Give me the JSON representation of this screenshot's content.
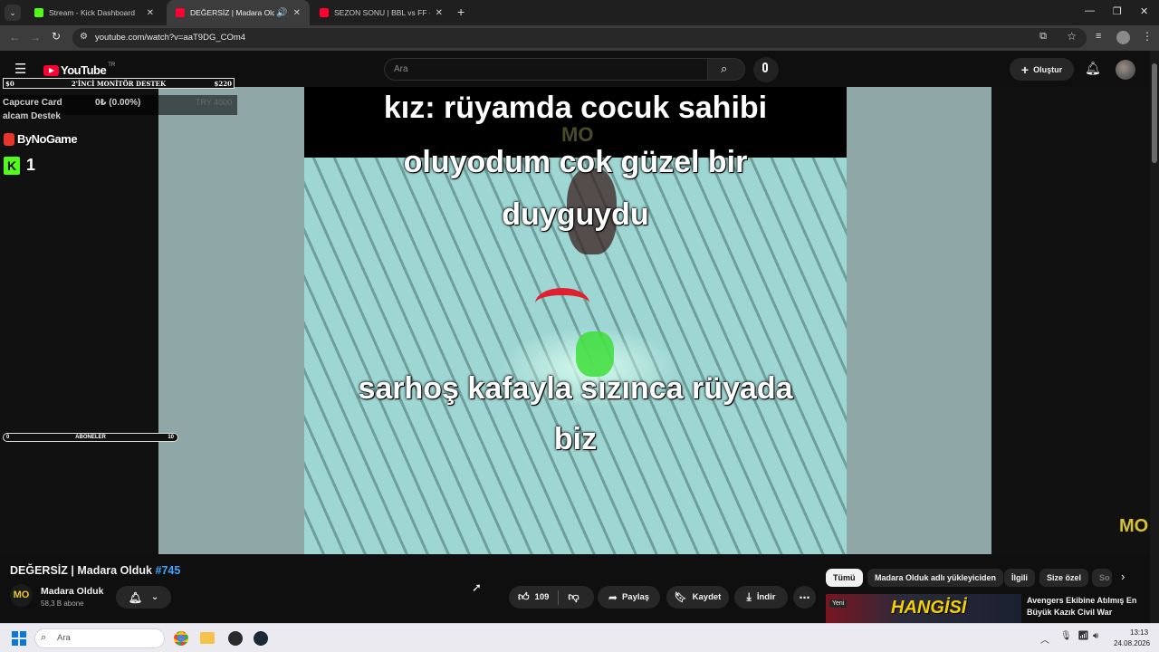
{
  "browser": {
    "tabs": [
      {
        "title": "Stream - Kick Dashboard",
        "favicon_color": "#53fc18"
      },
      {
        "title": "DEĞERSİZ | Madara Olduk #",
        "favicon_color": "#ff0033"
      },
      {
        "title": "SEZON SONU | BBL vs FF - You",
        "favicon_color": "#ff0033"
      }
    ],
    "url": "youtube.com/watch?v=aaT9DG_COm4"
  },
  "youtube": {
    "logo_text": "YouTube",
    "region": "TR",
    "search_placeholder": "Ara",
    "create_label": "Oluştur"
  },
  "overlays": {
    "bar1_left": "$0",
    "bar1_title": "2'İNCİ MONİTÖR DESTEK",
    "bar1_right": "$220",
    "capture_label": "Capcure Card",
    "capture_sub": "alcam Destek",
    "capture_amount": "0₺ (0.00%)",
    "capture_goal": "TRY 4000",
    "bynogame": "ByNoGame",
    "kick_count": "1",
    "aboneler_left": "0",
    "aboneler_title": "ABONELER",
    "aboneler_right": "10"
  },
  "video": {
    "caption_top": [
      "kız: rüyamda cocuk sahibi",
      "oluyodum cok güzel bir",
      "duyguydu"
    ],
    "caption_bottom": [
      "sarhoş kafayla sızınca rüyada",
      "biz"
    ],
    "watermark": "M₀"
  },
  "watch": {
    "title": "DEĞERSİZ | Madara Olduk",
    "hashtag": "#745",
    "channel": "Madara Olduk",
    "subscribers": "58,3 B abone",
    "likes": "109",
    "share": "Paylaş",
    "save": "Kaydet",
    "download": "İndir"
  },
  "chips": [
    "Tümü",
    "Madara Olduk adlı yükleyiciden",
    "İlgili",
    "Size özel",
    "So"
  ],
  "recommendation": {
    "badge": "Yeni",
    "thumb_text": "HANGİSİ",
    "title_line1": "Avengers Ekibine Atılmış En",
    "title_line2": "Büyük Kazık Civil War"
  },
  "taskbar": {
    "search_label": "Ara",
    "time": "13:13",
    "date": "24.08.2026"
  }
}
